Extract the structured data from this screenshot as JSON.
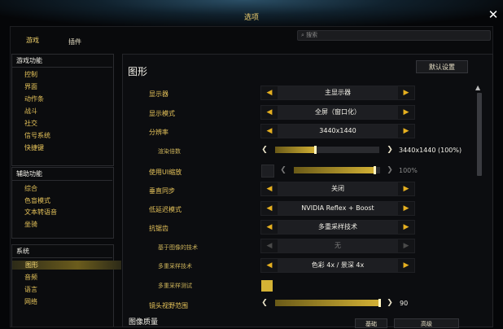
{
  "window": {
    "title": "选项"
  },
  "tabs": [
    {
      "label": "游戏"
    },
    {
      "label": "插件"
    }
  ],
  "search": {
    "placeholder": "搜索"
  },
  "sidebar": {
    "groups": [
      {
        "title": "游戏功能",
        "items": [
          "控制",
          "界面",
          "动作条",
          "战斗",
          "社交",
          "信号系统",
          "快捷键"
        ]
      },
      {
        "title": "辅助功能",
        "items": [
          "综合",
          "色盲模式",
          "文本转语音",
          "坐骑"
        ]
      },
      {
        "title": "系统",
        "items": [
          "图形",
          "音频",
          "语言",
          "网络"
        ],
        "active_index": 0
      }
    ]
  },
  "main": {
    "section_title": "图形",
    "default_button": "默认设置",
    "rows": {
      "display": {
        "label": "显示器",
        "value": "主显示器"
      },
      "display_mode": {
        "label": "显示模式",
        "value": "全屏（窗口化）"
      },
      "resolution": {
        "label": "分辨率",
        "value": "3440x1440"
      },
      "render_scale": {
        "label": "渲染倍数",
        "value": "3440x1440 (100%)",
        "level": 0.4
      },
      "ui_scale": {
        "label": "使用UI缩放",
        "value": "100%",
        "level": 0.95
      },
      "vsync": {
        "label": "垂直同步",
        "value": "关闭"
      },
      "low_latency": {
        "label": "低延迟模式",
        "value": "NVIDIA Reflex + Boost"
      },
      "antialiasing": {
        "label": "抗锯齿",
        "value": "多重采样技术"
      },
      "image_based": {
        "label": "基于图像的技术",
        "value": "无"
      },
      "msaa": {
        "label": "多重采样技术",
        "value": "色彩 4x / 景深 4x"
      },
      "msaa_test": {
        "label": "多重采样测试"
      },
      "fov": {
        "label": "镜头视野范围",
        "value": "90",
        "level": 1.0
      }
    },
    "section2_title": "图像质量",
    "bottom_buttons": [
      "基础",
      "高级"
    ]
  },
  "colors": {
    "accent": "#e6c35a",
    "arrow": "#e6b020",
    "fill": "#d4b235"
  }
}
